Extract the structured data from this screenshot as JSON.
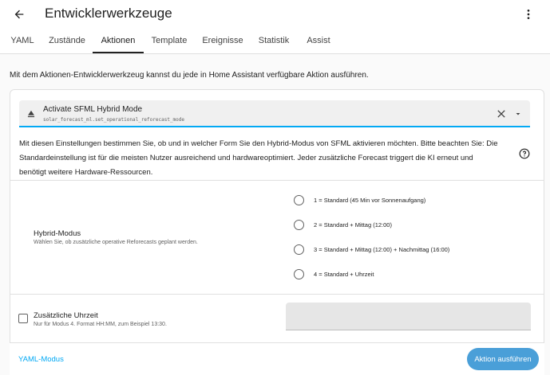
{
  "header": {
    "title": "Entwicklerwerkzeuge",
    "icons": {
      "back": "arrow-left-icon",
      "more": "more-vert-icon"
    }
  },
  "tabs": [
    {
      "label": "YAML",
      "active": false
    },
    {
      "label": "Zustände",
      "active": false
    },
    {
      "label": "Aktionen",
      "active": true
    },
    {
      "label": "Template",
      "active": false
    },
    {
      "label": "Ereignisse",
      "active": false
    },
    {
      "label": "Statistik",
      "active": false
    },
    {
      "label": "Assist",
      "active": false
    }
  ],
  "intro": "Mit dem Aktionen-Entwicklerwerkzeug kannst du jede in Home Assistant verfügbare Aktion ausführen.",
  "action_picker": {
    "title": "Activate SFML Hybrid Mode",
    "service": "solar_forecast_ml.set_operational_reforecast_mode",
    "accent_color": "#03a9f4"
  },
  "description": "Mit diesen Einstellungen bestimmen Sie, ob und in welcher Form Sie den Hybrid-Modus von SFML aktivieren möchten. Bitte beachten Sie: Die Standardeinstellung ist für die meisten Nutzer ausreichend und hardwareoptimiert. Jeder zusätzliche Forecast triggert die KI erneut und benötigt weitere Hardware-Ressourcen.",
  "hybrid_mode": {
    "title": "Hybrid-Modus",
    "subtitle": "Wählen Sie, ob zusätzliche operative Reforecasts geplant werden.",
    "options": [
      {
        "label": "1 = Standard (45 Min vor Sonnenaufgang)",
        "selected": false
      },
      {
        "label": "2 = Standard + Mittag (12:00)",
        "selected": false
      },
      {
        "label": "3 = Standard + Mittag (12:00) + Nachmittag (16:00)",
        "selected": false
      },
      {
        "label": "4 = Standard + Uhrzeit",
        "selected": false
      }
    ]
  },
  "extra_time": {
    "title": "Zusätzliche Uhrzeit",
    "subtitle": "Nur für Modus 4. Format HH:MM, zum Beispiel 13:30.",
    "value": "",
    "checked": false
  },
  "footer": {
    "yaml_mode": "YAML-Modus",
    "run_action": "Aktion ausführen",
    "button_color": "#4a9fd8"
  }
}
